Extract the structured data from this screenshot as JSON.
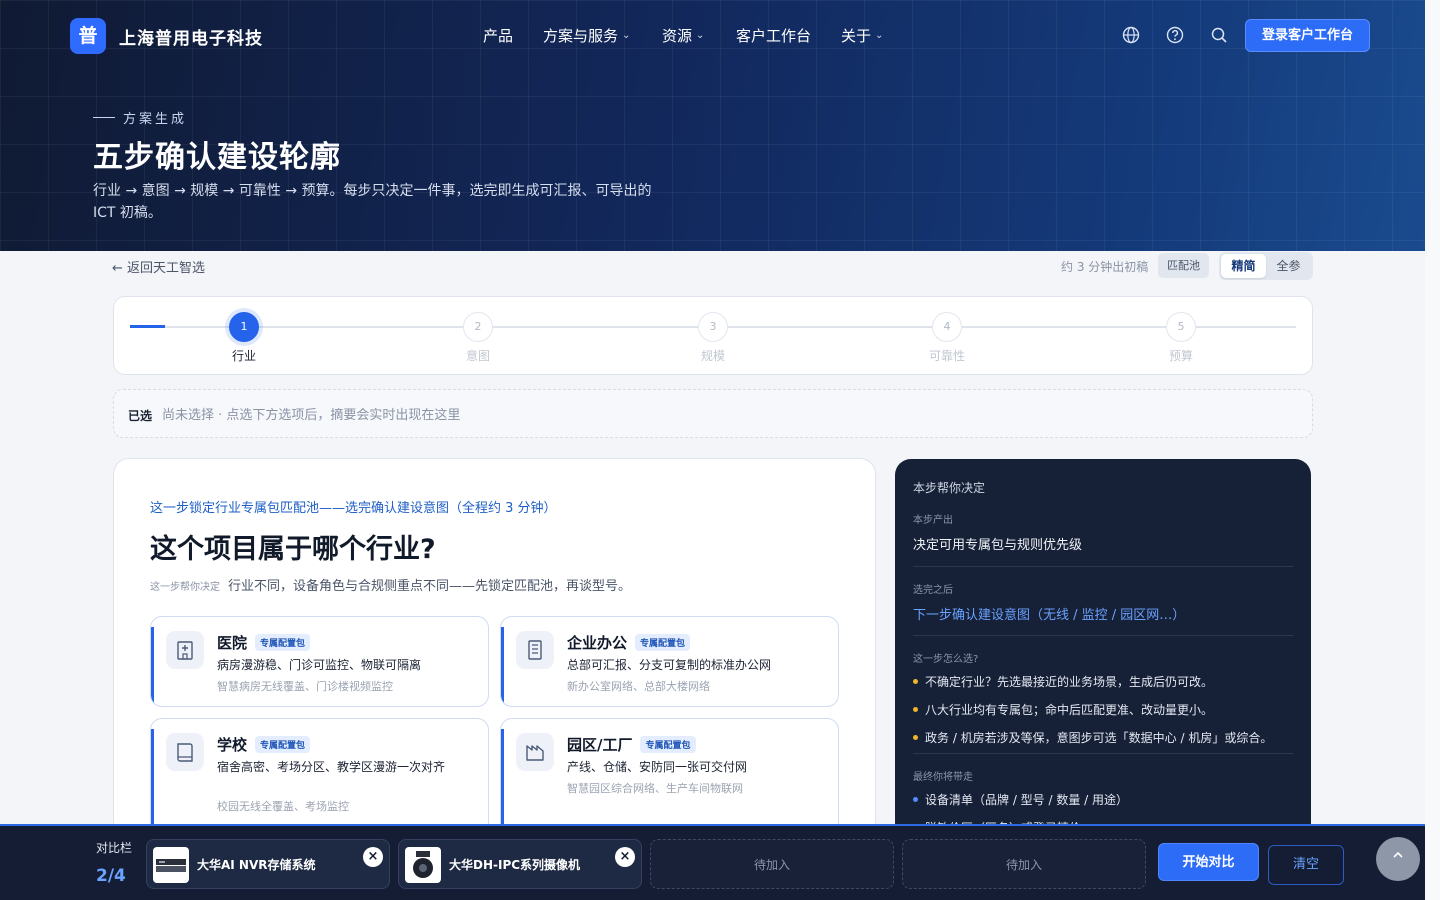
{
  "nav": {
    "logo_char": "普",
    "brand": "上海普用电子科技",
    "menu": [
      "产品",
      "方案与服务",
      "资源",
      "客户工作台",
      "关于"
    ],
    "login_label": "登录客户工作台",
    "icons": [
      "globe-icon",
      "help-icon",
      "search-icon"
    ]
  },
  "hero": {
    "eyebrow": "方案生成",
    "title": "五步确认建设轮廓",
    "desc": "行业 → 意图 → 规模 → 可靠性 → 预算。每步只决定一件事，选完即生成可汇报、可导出的 ICT 初稿。"
  },
  "subbar": {
    "back": "← 返回天工智选",
    "estimate": "约 3 分钟出初稿",
    "pool": "匹配池",
    "modes": [
      "精简",
      "全参"
    ],
    "active_mode": "精简"
  },
  "stepper": {
    "steps": [
      {
        "num": "1",
        "label": "行业"
      },
      {
        "num": "2",
        "label": "意图"
      },
      {
        "num": "3",
        "label": "规模"
      },
      {
        "num": "4",
        "label": "可靠性"
      },
      {
        "num": "5",
        "label": "预算"
      }
    ],
    "current": 1
  },
  "selected": {
    "label": "已选",
    "value": "尚未选择 · 点选下方选项后，摘要会实时出现在这里"
  },
  "question": {
    "kicker": "这一步锁定行业专属包匹配池——选完确认建设意图（全程约 3 分钟）",
    "title": "这个项目属于哪个行业?",
    "hint_prefix": "这一步帮你决定",
    "hint": "行业不同，设备角色与合规侧重点不同——先锁定匹配池，再谈型号。",
    "badge": "专属配置包",
    "options": [
      {
        "name": "医院",
        "desc": "病房漫游稳、门诊可监控、物联可隔离",
        "sub": "智慧病房无线覆盖、门诊楼视频监控",
        "icon": "hospital-icon"
      },
      {
        "name": "企业办公",
        "desc": "总部可汇报、分支可复制的标准办公网",
        "sub": "新办公室网络、总部大楼网络",
        "icon": "building-icon"
      },
      {
        "name": "学校",
        "desc": "宿舍高密、考场分区、教学区漫游一次对齐",
        "sub": "校园无线全覆盖、考场监控",
        "icon": "book-icon"
      },
      {
        "name": "园区/工厂",
        "desc": "产线、仓储、安防同一张可交付网",
        "sub": "智慧园区综合网络、生产车间物联网",
        "icon": "factory-icon"
      }
    ]
  },
  "side": {
    "title": "本步帮你决定",
    "output_label": "本步产出",
    "output_value": "决定可用专属包与规则优先级",
    "next_label": "选完之后",
    "next_value": "下一步确认建设意图（无线 / 监控 / 园区网…）",
    "how_label": "这一步怎么选?",
    "how_items": [
      "不确定行业？先选最接近的业务场景，生成后仍可改。",
      "八大行业均有专属包；命中后匹配更准、改动量更小。",
      "政务 / 机房若涉及等保，意图步可选「数据中心 / 机房」或综合。"
    ],
    "take_label": "最终你将带走",
    "take_items": [
      "设备清单（品牌 / 型号 / 数量 / 用途）",
      "脱敏价区（匿名）或登录精价"
    ]
  },
  "compare": {
    "label": "对比栏",
    "count": "2/4",
    "items": [
      {
        "name": "大华AI NVR存储系统",
        "state": "filled"
      },
      {
        "name": "大华DH-IPC系列摄像机",
        "state": "filled"
      },
      {
        "name": "待加入",
        "state": "empty"
      },
      {
        "name": "待加入",
        "state": "empty"
      }
    ],
    "close_glyph": "×",
    "start_label": "开始对比",
    "clear_label": "清空"
  },
  "colors": {
    "accent": "#2563eb",
    "hero_dark": "#101a33",
    "side_bg": "#162036",
    "bullet_yellow": "#f0b429"
  }
}
